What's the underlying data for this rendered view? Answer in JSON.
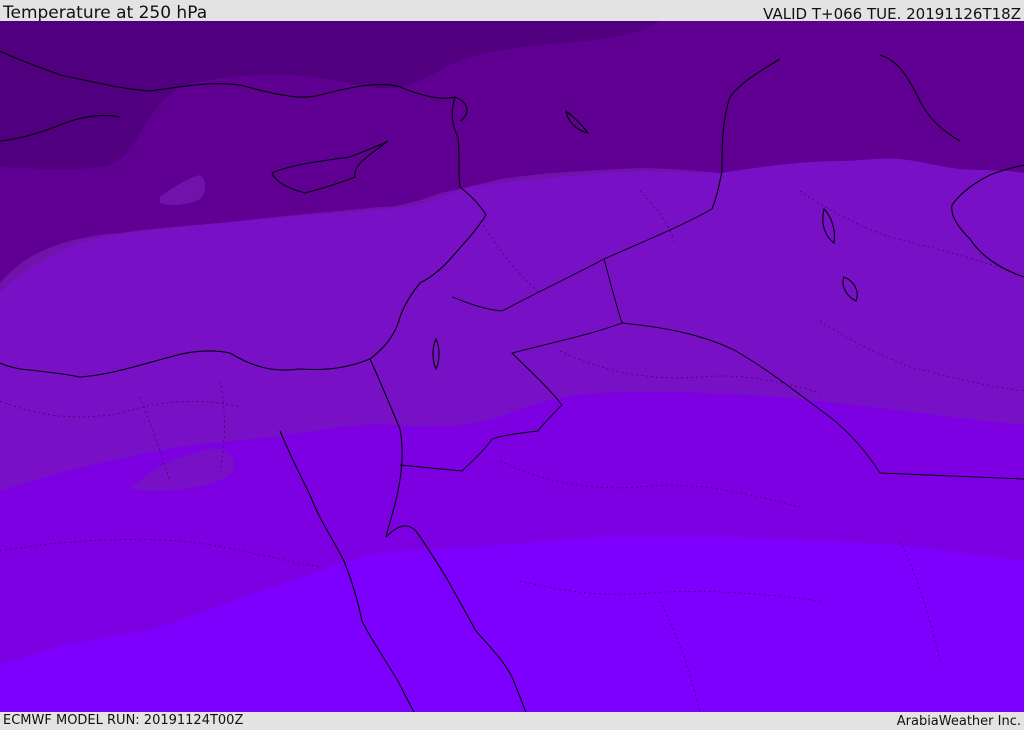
{
  "header": {
    "title": "Temperature at 250 hPa",
    "valid": "VALID T+066 TUE. 20191126T18Z"
  },
  "footer": {
    "model_run": "ECMWF MODEL RUN: 20191124T00Z",
    "credit": "ArabiaWeather Inc."
  },
  "map": {
    "field": "temperature",
    "level_hpa": 250,
    "colors": {
      "band_darkest": "#50007f",
      "band_dark": "#5f0093",
      "band_mid": "#7013ab",
      "band_mid2": "#7810c6",
      "band_bright": "#7c00e2",
      "band_brightest": "#7d00ff",
      "coastline": "#000000",
      "header_bg": "#e3e3e3"
    }
  }
}
